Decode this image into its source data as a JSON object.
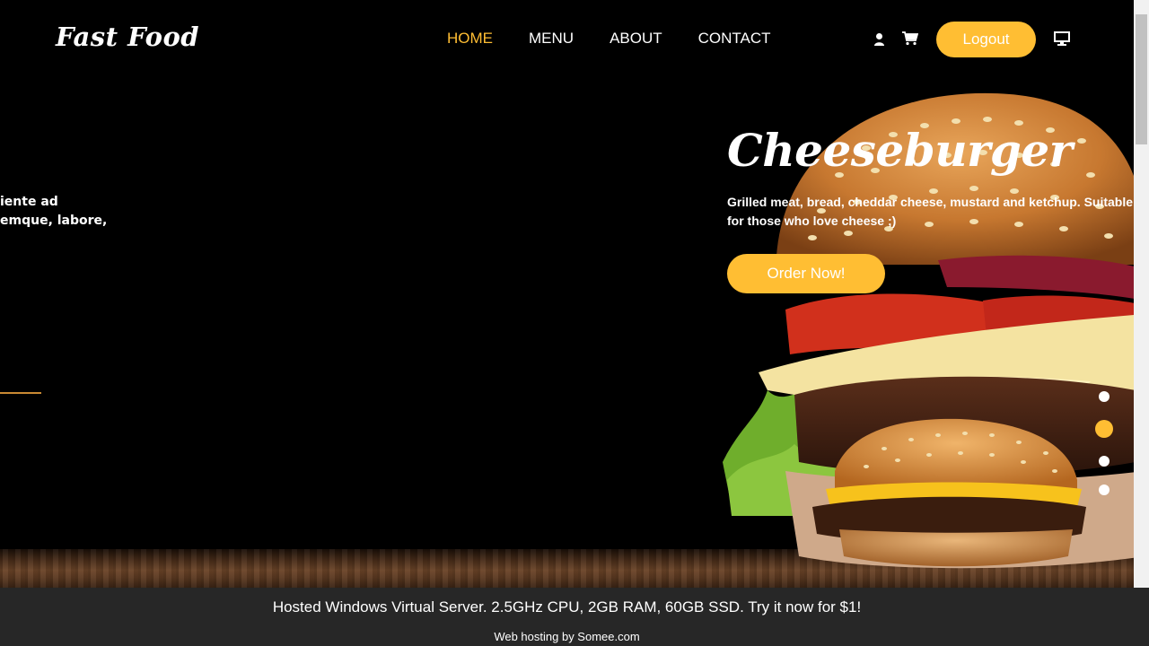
{
  "brand": {
    "name": "Fast Food"
  },
  "nav": {
    "items": [
      {
        "label": "HOME",
        "active": true
      },
      {
        "label": "MENU",
        "active": false
      },
      {
        "label": "ABOUT",
        "active": false
      },
      {
        "label": "CONTACT",
        "active": false
      }
    ],
    "user_icon": "user-icon",
    "cart_icon": "shopping-cart-icon",
    "logout_label": "Logout",
    "monitor_icon": "monitor-icon"
  },
  "previous_slide": {
    "text_line_1": "iente ad",
    "text_line_2": "emque, labore,"
  },
  "slide": {
    "title": "Cheeseburger",
    "description": "Grilled meat, bread, cheddar cheese, mustard and ketchup. Suitable for those who love cheese ;)",
    "cta_label": "Order Now!"
  },
  "carousel": {
    "count": 4,
    "active_index": 1
  },
  "hosting": {
    "ad_text": "Hosted Windows Virtual Server. 2.5GHz CPU, 2GB RAM, 60GB SSD. Try it now for $1!",
    "credit_text": "Web hosting by Somee.com"
  },
  "colors": {
    "accent": "#ffbe33",
    "background": "#000000",
    "footer": "#272727"
  }
}
